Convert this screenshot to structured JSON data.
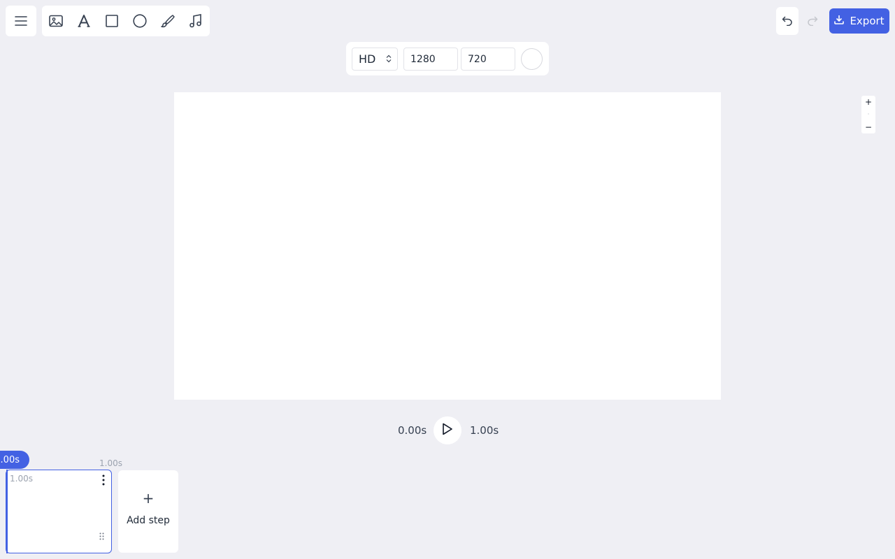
{
  "toolbar": {
    "tools": [
      {
        "name": "image-icon"
      },
      {
        "name": "text-icon"
      },
      {
        "name": "rectangle-icon"
      },
      {
        "name": "ellipse-icon"
      },
      {
        "name": "brush-icon"
      },
      {
        "name": "audio-icon"
      }
    ],
    "export_label": "Export"
  },
  "canvas_settings": {
    "preset": "HD",
    "width": "1280",
    "height": "720",
    "background_color": "#ffffff"
  },
  "zoom": {
    "in_label": "+",
    "out_label": "−"
  },
  "playback": {
    "current_time": "0.00s",
    "total_time": "1.00s"
  },
  "timeline": {
    "playhead_label": "0.00s",
    "step_end_time": "1.00s",
    "steps": [
      {
        "duration": "1.00s"
      }
    ],
    "add_step_label": "Add step"
  },
  "colors": {
    "accent": "#4361e3",
    "background": "#efeff4"
  }
}
